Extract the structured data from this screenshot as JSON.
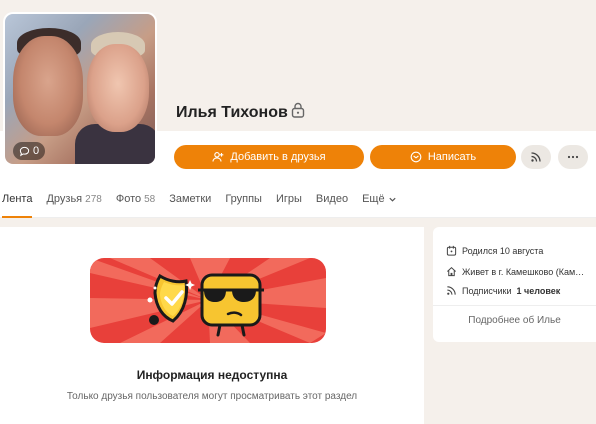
{
  "profile": {
    "name": "Илья Тихонов",
    "photo_count_badge": "0"
  },
  "actions": {
    "add_friend": "Добавить в друзья",
    "message": "Написать"
  },
  "tabs": [
    {
      "label": "Лента",
      "count": ""
    },
    {
      "label": "Друзья",
      "count": "278"
    },
    {
      "label": "Фото",
      "count": "58"
    },
    {
      "label": "Заметки",
      "count": ""
    },
    {
      "label": "Группы",
      "count": ""
    },
    {
      "label": "Игры",
      "count": ""
    },
    {
      "label": "Видео",
      "count": ""
    },
    {
      "label": "Ещё",
      "count": ""
    }
  ],
  "main": {
    "title": "Информация недоступна",
    "subtitle": "Только друзья пользователя могут просматривать этот раздел"
  },
  "sidebar": {
    "born": "Родился 10 августа",
    "lives": "Живет в г. Камешково (Кам…",
    "subscribers_label": "Подписчики",
    "subscribers_value": "1 человек",
    "more": "Подробнее об Илье"
  },
  "colors": {
    "accent": "#ee8208",
    "background": "#f5f0eb"
  }
}
